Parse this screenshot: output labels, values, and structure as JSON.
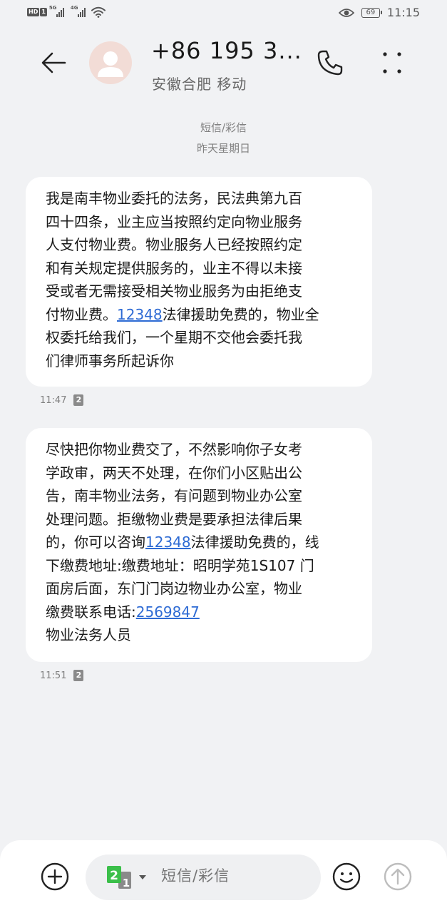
{
  "status_bar": {
    "hd": "HD",
    "sim": "1",
    "net1": "5G",
    "net2": "4G",
    "battery": "69",
    "time": "11:15"
  },
  "header": {
    "contact_name": "+86 195 3...",
    "contact_location": "安徽合肥 移动"
  },
  "thread": {
    "type_label": "短信/彩信",
    "date_label": "昨天星期日"
  },
  "messages": [
    {
      "text_before": "我是南丰物业委托的法务，民法典第九百\n四十四条，业主应当按照约定向物业服务\n人支付物业费。物业服务人已经按照约定\n和有关规定提供服务的，业主不得以未接\n受或者无需接受相关物业服务为由拒绝支\n付物业费。",
      "link": "12348",
      "text_after": "法律援助免费的，物业全\n权委托给我们，一个星期不交他会委托我\n们律师事务所起诉你",
      "time": "11:47",
      "sim": "2"
    },
    {
      "text_before": "尽快把你物业费交了，不然影响你子女考\n学政审，两天不处理，在你们小区贴出公\n告，南丰物业法务，有问题到物业办公室\n处理问题。拒缴物业费是要承担法律后果\n的，你可以咨询",
      "link": "12348",
      "text_middle": "法律援助免费的，线\n下缴费地址:缴费地址：昭明学苑1S107 门\n面房后面，东门门岗边物业办公室，物业\n缴费联系电话:",
      "link2": "2569847",
      "text_after": "\n物业法务人员",
      "time": "11:51",
      "sim": "2"
    }
  ],
  "composer": {
    "placeholder": "短信/彩信",
    "sim_active": "2",
    "sim_other": "1"
  },
  "colors": {
    "background": "#f1f2f4",
    "bubble": "#ffffff",
    "link": "#2e6bd4",
    "sim_green": "#3bbf4a"
  },
  "icons": {
    "back": "arrow-left-icon",
    "call": "phone-icon",
    "more": "more-vertical-icon",
    "add": "plus-circle-icon",
    "emoji": "smiley-icon",
    "send": "send-arrow-icon"
  }
}
